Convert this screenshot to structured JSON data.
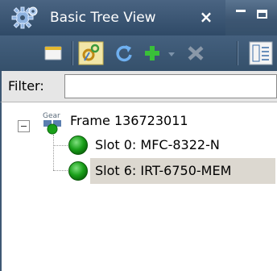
{
  "view": {
    "title": "Basic Tree View",
    "close_glyph": "×"
  },
  "toolbar": {
    "buttons": [
      {
        "name": "device-icon"
      },
      {
        "name": "settings-icon"
      },
      {
        "name": "refresh-icon"
      },
      {
        "name": "add-icon"
      },
      {
        "name": "dropdown-arrow-icon"
      },
      {
        "name": "remove-icon"
      },
      {
        "name": "tree-layout-icon"
      }
    ]
  },
  "filter": {
    "label": "Filter:",
    "value": ""
  },
  "tree": {
    "root": {
      "icon_text": "Gear",
      "label": "Frame 136723011",
      "expanded": true,
      "children": [
        {
          "label": "Slot 0: MFC-8322-N",
          "status_color": "#1aa01a",
          "selected": false
        },
        {
          "label": "Slot 6: IRT-6750-MEM",
          "status_color": "#1aa01a",
          "selected": true
        }
      ]
    }
  },
  "colors": {
    "titlebar": "#3d5672",
    "selection": "#dcd8d0",
    "status_ok": "#1aa01a"
  }
}
